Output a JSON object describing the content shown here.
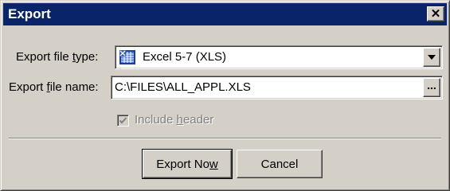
{
  "window": {
    "title": "Export"
  },
  "file_type": {
    "label": "Export file type:",
    "value": "Excel 5-7 (XLS)",
    "icon": "excel-file-icon"
  },
  "file_name": {
    "label": "Export file name:",
    "value": "C:\\FILES\\ALL_APPL.XLS",
    "browse_label": "..."
  },
  "include_header": {
    "label": "Include header",
    "checked": true,
    "enabled": false
  },
  "buttons": {
    "export_now": "Export Now",
    "cancel": "Cancel"
  },
  "colors": {
    "titlebar": "#0a246a",
    "face": "#d4d0c8",
    "disabled_text": "#808080"
  }
}
